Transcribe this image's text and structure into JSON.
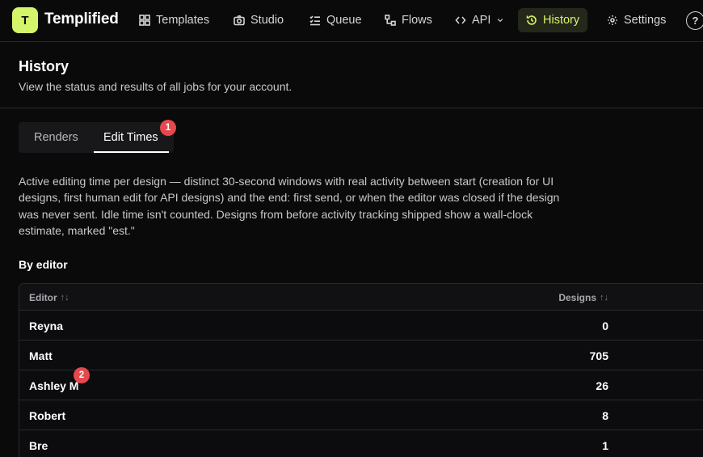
{
  "app": {
    "logo_letter": "T",
    "name": "Templified"
  },
  "nav": {
    "items": [
      {
        "label": "Templates",
        "icon": "grid-icon"
      },
      {
        "label": "Studio",
        "icon": "camera-icon"
      },
      {
        "label": "Queue",
        "icon": "checklist-icon"
      },
      {
        "label": "Flows",
        "icon": "flow-icon"
      },
      {
        "label": "API",
        "icon": "code-icon"
      },
      {
        "label": "History",
        "icon": "history-icon",
        "active": true
      },
      {
        "label": "Settings",
        "icon": "gear-icon"
      }
    ],
    "help": "?"
  },
  "page": {
    "title": "History",
    "subtitle": "View the status and results of all jobs for your account."
  },
  "tabs": {
    "renders": "Renders",
    "edit_times": "Edit Times",
    "active": "Edit Times"
  },
  "badges": {
    "one": "1",
    "two": "2"
  },
  "description": "Active editing time per design — distinct 30-second windows with real activity between start (creation for UI designs, first human edit for API designs) and the end: first send, or when the editor was closed if the design was never sent. Idle time isn't counted. Designs from before activity tracking shipped show a wall-clock estimate, marked \"est.\"",
  "section": {
    "by_editor": "By editor"
  },
  "table": {
    "columns": {
      "editor": "Editor",
      "designs": "Designs",
      "sort_glyph": "↑↓"
    },
    "rows": [
      {
        "editor": "Reyna",
        "designs": "0"
      },
      {
        "editor": "Matt",
        "designs": "705"
      },
      {
        "editor": "Ashley M",
        "designs": "26"
      },
      {
        "editor": "Robert",
        "designs": "8"
      },
      {
        "editor": "Bre",
        "designs": "1"
      }
    ]
  },
  "colors": {
    "accent": "#d4f56a",
    "background": "#0a0a0b",
    "badge": "#e5484d"
  }
}
